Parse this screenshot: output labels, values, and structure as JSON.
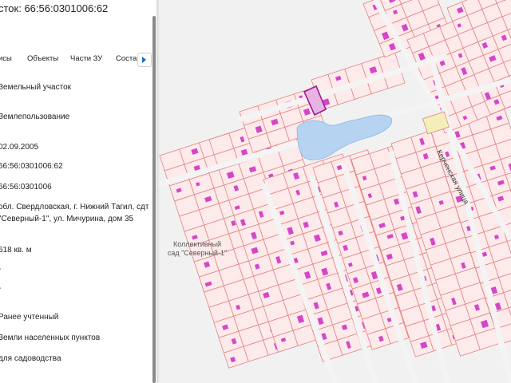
{
  "panel": {
    "title": "сток: 66:56:0301006:62",
    "tabs": [
      "исы",
      "Объекты",
      "Части ЗУ",
      "Соста"
    ],
    "fields": [
      "Земельный участок",
      "Землепользование",
      "02.09.2005",
      "66:56:0301006:62",
      "66:56:0301006",
      "обл. Свердловская, г. Нижний Тагил, сдт \"Северный-1\", ул. Мичурина, дом 35",
      "618 кв. м",
      "-",
      "-",
      "Ранее учтенный",
      "Земли населенных пунктов",
      "для садоводства"
    ]
  },
  "map": {
    "area_label_line1": "Коллективный",
    "area_label_line2": "сад \"Северный-1\"",
    "street_label": "Керченская улица",
    "colors": {
      "background": "#f1f1f1",
      "parcel_fill": "#fdeaea",
      "parcel_stroke": "#e28484",
      "building": "#d546c8",
      "selected_stroke": "#9b1d8f",
      "water": "#b6d3f2",
      "green_parcel": "#f4efb8"
    }
  }
}
